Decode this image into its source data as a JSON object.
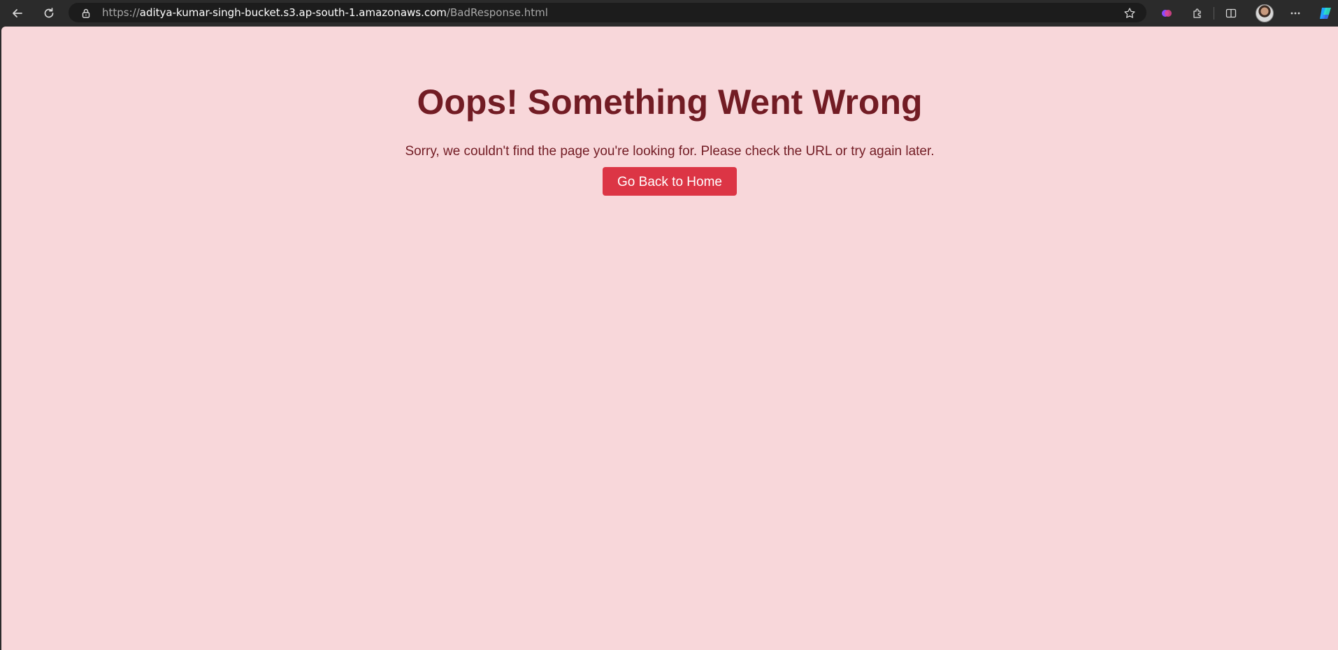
{
  "browser": {
    "url_scheme": "https://",
    "url_host": "aditya-kumar-singh-bucket.s3.ap-south-1.amazonaws.com",
    "url_path": "/BadResponse.html",
    "icons": [
      "back-icon",
      "reload-icon",
      "lock-icon",
      "star-icon",
      "extension-color-icon",
      "puzzle-icon",
      "split-screen-icon",
      "avatar",
      "more-icon",
      "copilot-icon"
    ]
  },
  "page": {
    "title": "Oops! Something Went Wrong",
    "message": "Sorry, we couldn't find the page you're looking for. Please check the URL or try again later.",
    "button_label": "Go Back to Home"
  },
  "colors": {
    "background": "#f8d7da",
    "text": "#721c24",
    "button": "#dc3545",
    "button_text": "#ffffff"
  }
}
